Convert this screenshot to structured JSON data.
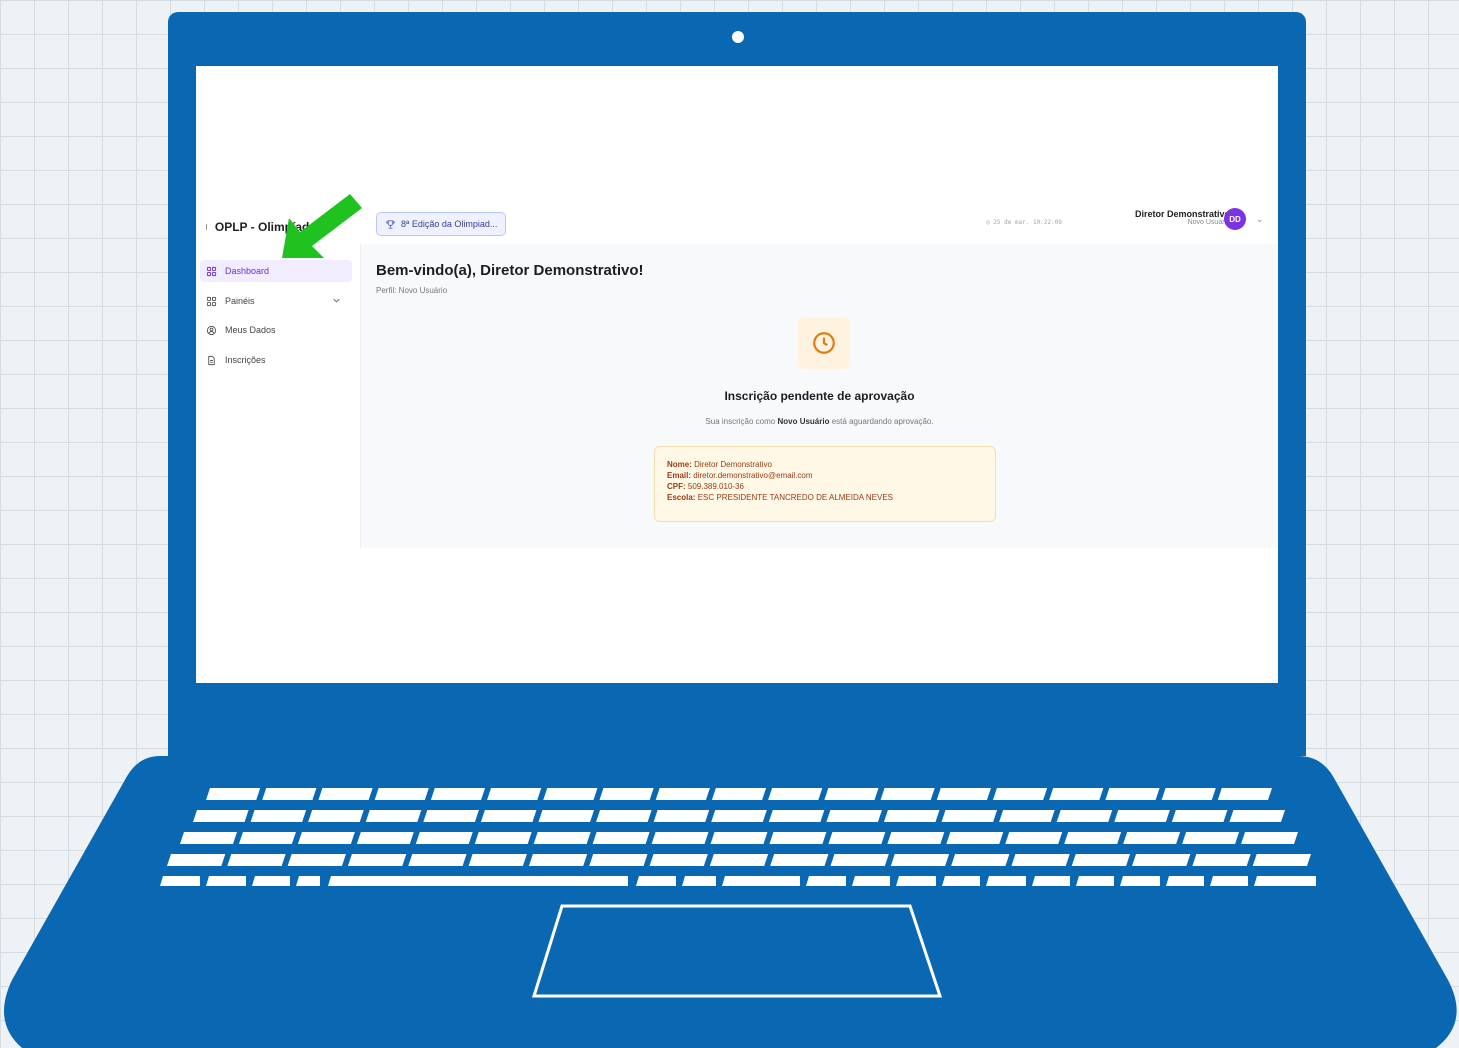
{
  "brand": {
    "name": "OPLP - Olimpíada"
  },
  "header": {
    "edition_label": "8ª Edição da Olimpiad...",
    "datetime": "25 de mar. 10:22:09",
    "user_name": "Diretor Demonstrativo",
    "user_role": "Novo Usuário",
    "avatar_initials": "DD"
  },
  "sidebar": {
    "items": [
      {
        "label": "Dashboard",
        "icon": "grid-icon",
        "active": true
      },
      {
        "label": "Painéis",
        "icon": "grid-icon",
        "expandable": true
      },
      {
        "label": "Meus Dados",
        "icon": "user-circle-icon"
      },
      {
        "label": "Inscrições",
        "icon": "document-icon"
      }
    ]
  },
  "main": {
    "welcome": "Bem-vindo(a), Diretor Demonstrativo!",
    "profile": "Perfil: Novo Usuário",
    "pending_title": "Inscrição pendente de aprovação",
    "pending_sub_before": "Sua inscrição como",
    "pending_sub_role": "Novo Usuário",
    "pending_sub_after": "está aguardando aprovação.",
    "info": {
      "nome_label": "Nome:",
      "nome": "Diretor Demonstrativo",
      "email_label": "Email:",
      "email": "diretor.demonstrativo@email.com",
      "cpf_label": "CPF:",
      "cpf": "509.389.010-36",
      "escola_label": "Escola:",
      "escola": "ESC PRESIDENTE TANCREDO DE ALMEIDA NEVES"
    }
  },
  "colors": {
    "laptop": "#0a68b2",
    "accent": "#6a2fd6",
    "avatar": "#7b35e0",
    "arrow": "#1fc21f",
    "pending": "#e07b12"
  }
}
